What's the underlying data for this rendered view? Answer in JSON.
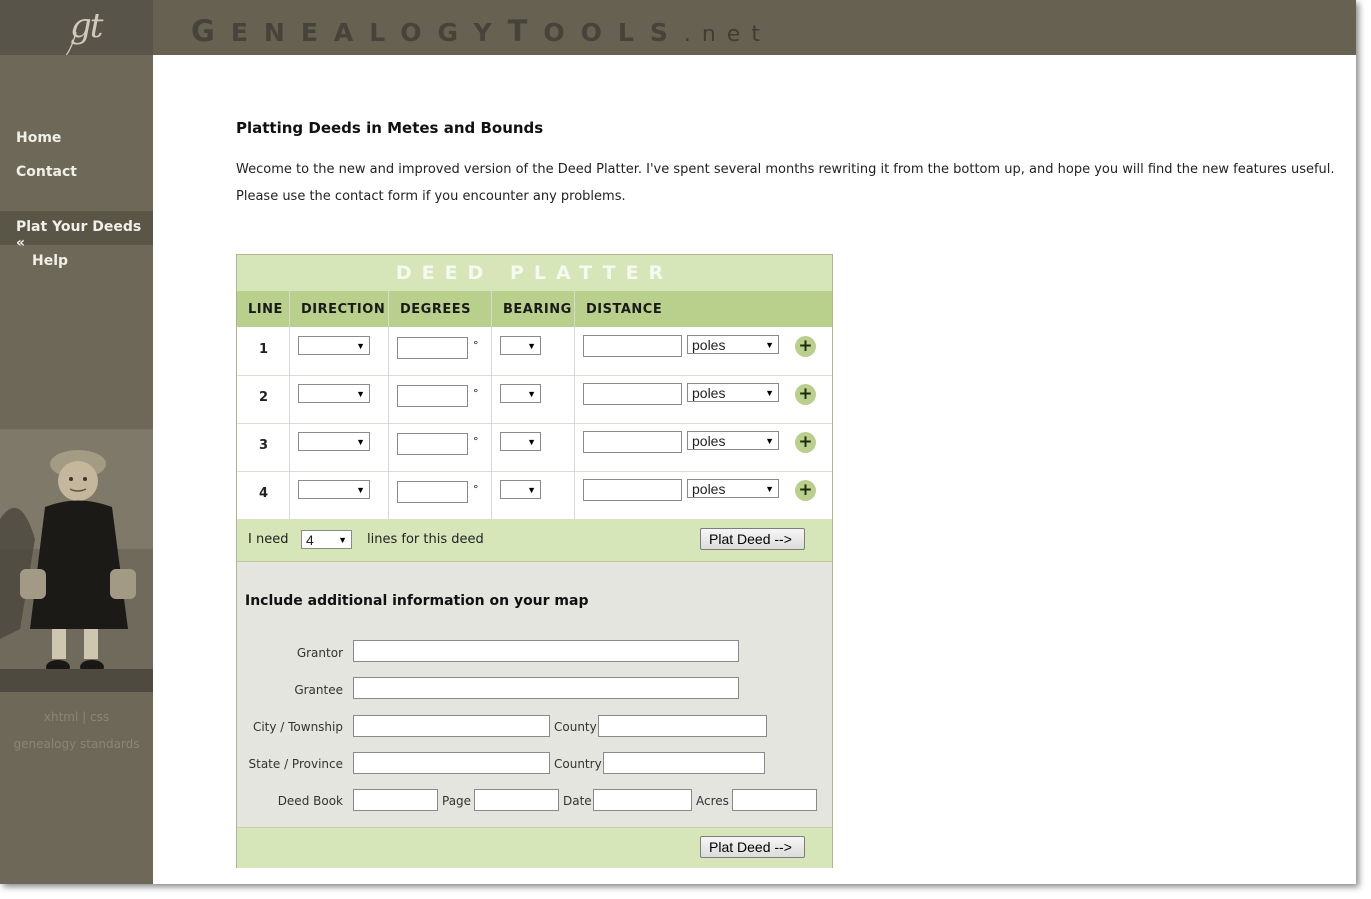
{
  "header": {
    "logo_text": "gt",
    "title_parts": [
      "G",
      "ENEALOGY",
      "T",
      "OOLS",
      ".net"
    ]
  },
  "sidebar": {
    "items": [
      {
        "label": "Home"
      },
      {
        "label": "Contact"
      },
      {
        "label": "Plat Your Deeds «"
      },
      {
        "label": "Help"
      }
    ],
    "footer_line1": "xhtml | css",
    "footer_line2": "genealogy standards"
  },
  "main": {
    "heading": "Platting Deeds in Metes and Bounds",
    "intro": "Wecome to the new and improved version of the Deed Platter. I've spent several months rewriting it from the bottom up, and hope you will find the new features useful. Please use the contact form if you encounter any problems."
  },
  "platter": {
    "title": "DEED PLATTER",
    "columns": {
      "line": "LINE",
      "direction": "DIRECTION",
      "degrees": "DEGREES",
      "bearing": "BEARING",
      "distance": "DISTANCE"
    },
    "degree_symbol": "°",
    "rows": [
      {
        "line": "1",
        "unit": "poles",
        "add": "+"
      },
      {
        "line": "2",
        "unit": "poles",
        "add": "+"
      },
      {
        "line": "3",
        "unit": "poles",
        "add": "+"
      },
      {
        "line": "4",
        "unit": "poles",
        "add": "+"
      }
    ],
    "need_prefix": "I need",
    "need_value": "4",
    "need_suffix": "lines for this deed",
    "plat_button": "Plat Deed -->",
    "additional_title": "Include additional information on your map",
    "fields": {
      "grantor": "Grantor",
      "grantee": "Grantee",
      "city": "City / Township",
      "county": "County",
      "state": "State / Province",
      "country": "Country",
      "deed_book": "Deed Book",
      "page": "Page",
      "date": "Date",
      "acres": "Acres"
    },
    "plat_button_bottom": "Plat Deed -->"
  },
  "colors": {
    "header_dark": "#585449",
    "header": "#676152",
    "sidebar": "#6d6857",
    "accent_green": "#b9d08c",
    "light_green": "#d6e6b9"
  }
}
